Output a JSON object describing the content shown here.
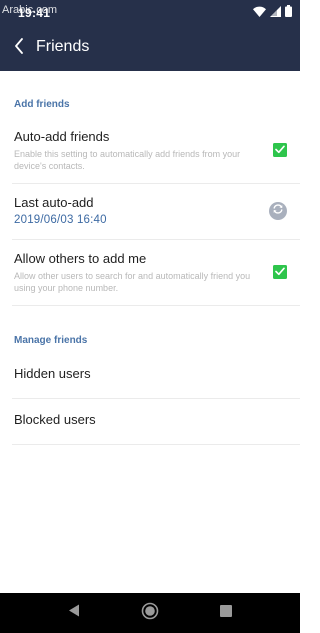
{
  "status_bar": {
    "time": "19:41",
    "watermark": "Arabic.com"
  },
  "app_bar": {
    "title": "Friends"
  },
  "sections": {
    "add_friends": {
      "header": "Add friends",
      "auto_add": {
        "title": "Auto-add friends",
        "description": "Enable this setting to automatically add friends from your device's contacts.",
        "checked": true
      },
      "last_auto_add": {
        "title": "Last auto-add",
        "value": "2019/06/03 16:40",
        "icon": "refresh-icon"
      },
      "allow_others": {
        "title": "Allow others to add me",
        "description": "Allow other users to search for and automatically friend you using your phone number.",
        "checked": true
      }
    },
    "manage_friends": {
      "header": "Manage friends",
      "hidden_users": "Hidden users",
      "blocked_users": "Blocked users"
    }
  },
  "colors": {
    "header_bg": "#26304a",
    "accent": "#4a74a8",
    "checkbox": "#2ec54c"
  },
  "nav_bar": {
    "icons": [
      "back-triangle-icon",
      "home-circle-icon",
      "recents-square-icon"
    ]
  }
}
